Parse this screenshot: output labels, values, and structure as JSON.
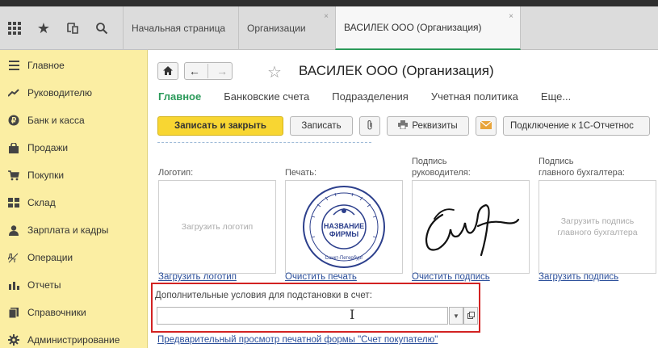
{
  "tabbar": {
    "tabs": [
      {
        "label": "Начальная страница"
      },
      {
        "label": "Организации",
        "close": "×"
      },
      {
        "label": "ВАСИЛЕК ООО (Организация)",
        "close": "×"
      }
    ]
  },
  "sidebar": {
    "items": [
      {
        "label": "Главное",
        "icon": "menu-icon"
      },
      {
        "label": "Руководителю",
        "icon": "chart-line-icon"
      },
      {
        "label": "Банк и касса",
        "icon": "coin-icon"
      },
      {
        "label": "Продажи",
        "icon": "bag-icon"
      },
      {
        "label": "Покупки",
        "icon": "cart-icon"
      },
      {
        "label": "Склад",
        "icon": "warehouse-icon"
      },
      {
        "label": "Зарплата и кадры",
        "icon": "person-icon"
      },
      {
        "label": "Операции",
        "icon": "operations-icon"
      },
      {
        "label": "Отчеты",
        "icon": "bar-chart-icon"
      },
      {
        "label": "Справочники",
        "icon": "books-icon"
      },
      {
        "label": "Администрирование",
        "icon": "gear-icon"
      }
    ]
  },
  "header": {
    "title": "ВАСИЛЕК ООО (Организация)"
  },
  "subtabs": [
    "Главное",
    "Банковские счета",
    "Подразделения",
    "Учетная политика",
    "Еще..."
  ],
  "toolbar": {
    "save_close": "Записать и закрыть",
    "save": "Записать",
    "requisites": "Реквизиты",
    "connect": "Подключение к 1С-Отчетнос"
  },
  "images": {
    "logo_label": "Логотип:",
    "stamp_label": "Печать:",
    "head_sign_label_1": "Подпись",
    "head_sign_label_2": "руководителя:",
    "acc_sign_label_1": "Подпись",
    "acc_sign_label_2": "главного бухгалтера:",
    "logo_placeholder": "Загрузить логотип",
    "acc_placeholder_1": "Загрузить подпись",
    "acc_placeholder_2": "главного бухгалтера",
    "stamp_text_1": "НАЗВАНИЕ",
    "stamp_text_2": "ФИРМЫ",
    "stamp_city": "Санкт-Петербург"
  },
  "links": {
    "upload_logo": "Загрузить логотип",
    "clear_stamp": "Очистить печать",
    "clear_sign": "Очистить подпись",
    "upload_sign": "Загрузить подпись",
    "preview": "Предварительный просмотр печатной формы \"Счет покупателю\""
  },
  "addcond": {
    "label": "Дополнительные условия для подстановки в счет:",
    "value": ""
  },
  "colors": {
    "sidebar_bg": "#fbeea3",
    "accent_green": "#2b9a5a",
    "primary_button": "#f8d632",
    "highlight_red": "#d22222",
    "link_blue": "#2a4e9a"
  }
}
